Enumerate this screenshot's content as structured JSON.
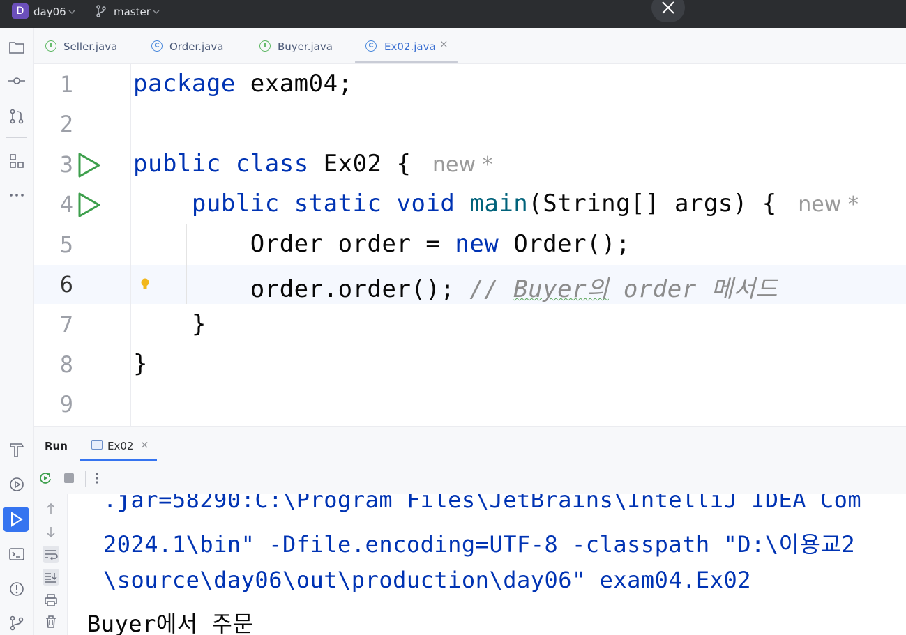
{
  "titlebar": {
    "project_badge": "D",
    "project_name": "day06",
    "branch": "master",
    "icons": [
      "chevron-down-icon",
      "branch-icon",
      "close-icon"
    ]
  },
  "tabs": [
    {
      "label": "Seller.java",
      "icon": "interface-icon",
      "icon_glyph": "I",
      "active": false
    },
    {
      "label": "Order.java",
      "icon": "class-icon",
      "icon_glyph": "C",
      "active": false
    },
    {
      "label": "Buyer.java",
      "icon": "interface-icon",
      "icon_glyph": "I",
      "active": false
    },
    {
      "label": "Ex02.java",
      "icon": "runnable-class-icon",
      "icon_glyph": "C",
      "active": true,
      "close": "×"
    }
  ],
  "editor": {
    "current_line": 6,
    "lines": [
      {
        "n": "1",
        "tokens": [
          {
            "t": "package",
            "c": "kw"
          },
          {
            "t": " exam04;",
            "c": ""
          }
        ]
      },
      {
        "n": "2",
        "tokens": []
      },
      {
        "n": "3",
        "tokens": [
          {
            "t": "public",
            "c": "kw"
          },
          {
            "t": " ",
            "c": ""
          },
          {
            "t": "class",
            "c": "kw"
          },
          {
            "t": " Ex02 { ",
            "c": ""
          }
        ],
        "hint": "new *",
        "run": true
      },
      {
        "n": "4",
        "tokens": [
          {
            "t": "    ",
            "c": ""
          },
          {
            "t": "public",
            "c": "kw"
          },
          {
            "t": " ",
            "c": ""
          },
          {
            "t": "static",
            "c": "kw"
          },
          {
            "t": " ",
            "c": ""
          },
          {
            "t": "void",
            "c": "kw"
          },
          {
            "t": " ",
            "c": ""
          },
          {
            "t": "main",
            "c": "fn"
          },
          {
            "t": "(String[] args) { ",
            "c": ""
          }
        ],
        "hint": "new *",
        "run": true
      },
      {
        "n": "5",
        "tokens": [
          {
            "t": "        Order order = ",
            "c": ""
          },
          {
            "t": "new",
            "c": "kw"
          },
          {
            "t": " Order();",
            "c": ""
          }
        ]
      },
      {
        "n": "6",
        "tokens": [
          {
            "t": "        order.order(); ",
            "c": ""
          },
          {
            "t": "// ",
            "c": "cm"
          },
          {
            "t": "Buyer의",
            "c": "cm squig"
          },
          {
            "t": " order 메서드",
            "c": "cm"
          }
        ],
        "bulb": true
      },
      {
        "n": "7",
        "tokens": [
          {
            "t": "    }",
            "c": ""
          }
        ]
      },
      {
        "n": "8",
        "tokens": [
          {
            "t": "}",
            "c": ""
          }
        ]
      },
      {
        "n": "9",
        "tokens": []
      }
    ]
  },
  "run_panel": {
    "title": "Run",
    "tab_label": "Ex02",
    "tab_close": "×",
    "console_lines": [
      {
        "text": ".jar=58290:C:\\Program Files\\JetBrains\\IntelliJ IDEA Com",
        "kind": "cmd"
      },
      {
        "text": "2024.1\\bin\" -Dfile.encoding=UTF-8 -classpath \"D:\\이용교2",
        "kind": "cmd"
      },
      {
        "text": "\\source\\day06\\out\\production\\day06\" exam04.Ex02",
        "kind": "cmd"
      },
      {
        "text": "Buyer에서 주문",
        "kind": "out"
      }
    ]
  },
  "colors": {
    "keyword": "#0033b3",
    "method": "#00627a",
    "comment": "#8c8c8c",
    "run_green": "#3d9f4c",
    "accent": "#3574f0"
  }
}
